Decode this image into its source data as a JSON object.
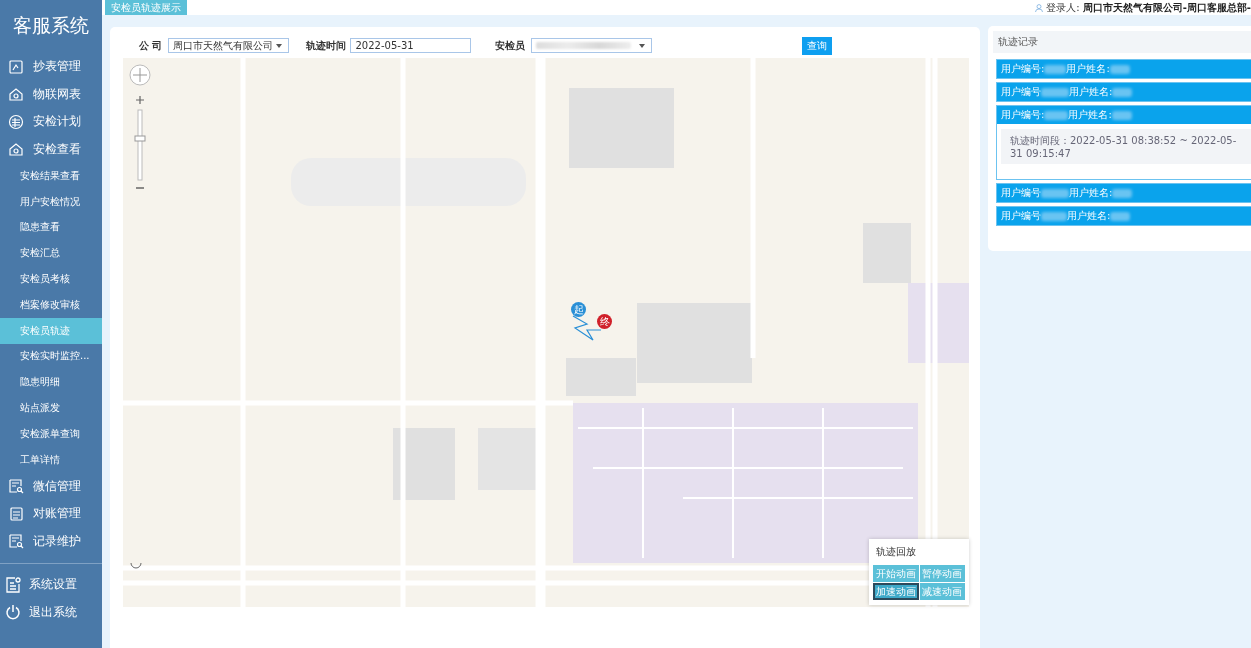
{
  "sidebar": {
    "title": "客服系统",
    "items": [
      {
        "label": "抄表管理"
      },
      {
        "label": "物联网表"
      },
      {
        "label": "安检计划"
      },
      {
        "label": "安检查看",
        "children": [
          {
            "label": "安检结果查看",
            "selected": false
          },
          {
            "label": "用户安检情况",
            "selected": false
          },
          {
            "label": "隐患查看",
            "selected": false
          },
          {
            "label": "安检汇总",
            "selected": false
          },
          {
            "label": "安检员考核",
            "selected": false
          },
          {
            "label": "档案修改审核",
            "selected": false
          },
          {
            "label": "安检员轨迹",
            "selected": true
          },
          {
            "label": "安检实时监控...",
            "selected": false
          },
          {
            "label": "隐患明细",
            "selected": false
          },
          {
            "label": "站点派发",
            "selected": false
          },
          {
            "label": "安检派单查询",
            "selected": false
          },
          {
            "label": "工单详情",
            "selected": false
          }
        ]
      },
      {
        "label": "微信管理"
      },
      {
        "label": "对账管理"
      },
      {
        "label": "记录维护"
      }
    ],
    "footer": [
      {
        "label": "系统设置"
      },
      {
        "label": "退出系统"
      }
    ]
  },
  "tabs": [
    {
      "label": "安检员轨迹展示",
      "selected": true
    }
  ],
  "login": {
    "label": "登录人:",
    "value": "周口市天然气有限公司-周口客服总部-"
  },
  "filters": {
    "company_label": "公 司",
    "company": "周口市天然气有限公司",
    "time_label": "轨迹时间",
    "time": "2022-05-31",
    "inspector_label": "安检员",
    "query_button": "查询"
  },
  "map": {
    "start_label": "起",
    "end_label": "终"
  },
  "playback": {
    "title": "轨迹回放",
    "buttons": [
      {
        "label": "开始动画",
        "selected": false
      },
      {
        "label": "暂停动画",
        "selected": false
      },
      {
        "label": "加速动画",
        "selected": true
      },
      {
        "label": "减速动画",
        "selected": false
      }
    ]
  },
  "records": {
    "title": "轨迹记录",
    "items": [
      {
        "id_label": "用户编号:",
        "name_label": "用户姓名:",
        "expanded": false
      },
      {
        "id_label": "用户编号",
        "name_label": "用户姓名:",
        "expanded": false
      },
      {
        "id_label": "用户编号:",
        "name_label": "用户姓名:",
        "expanded": true,
        "detail": "轨迹时间段：2022-05-31 08:38:52 ~ 2022-05-31 09:15:47"
      },
      {
        "id_label": "用户编号",
        "name_label": "用户姓名:",
        "expanded": false
      },
      {
        "id_label": "用户编号",
        "name_label": "用户姓名:",
        "expanded": false
      }
    ]
  }
}
